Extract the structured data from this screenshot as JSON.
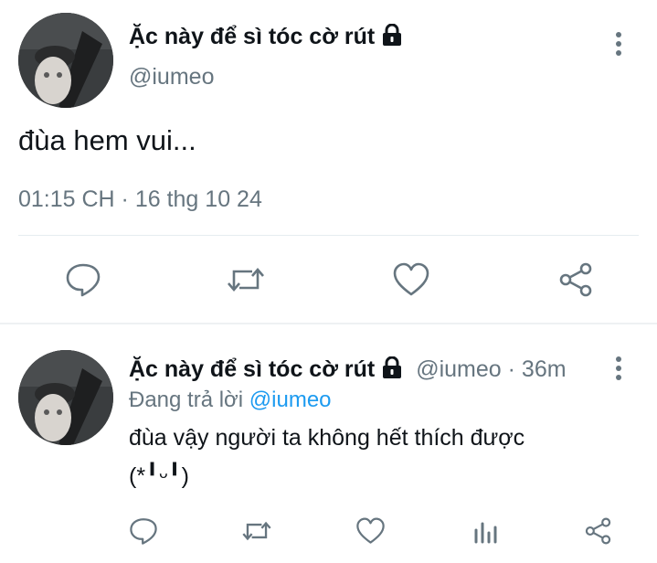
{
  "main_tweet": {
    "display_name": "Ặc này để sì tóc cờ rút",
    "handle": "@iumeo",
    "text": "đùa hem vui...",
    "timestamp": "01:15 CH · 16 thg 10 24",
    "actions": [
      "reply-icon",
      "retweet-icon",
      "like-icon",
      "share-icon"
    ],
    "more_icon": "more-vertical-icon"
  },
  "reply_tweet": {
    "display_name": "Ặc này để sì tóc cờ rút",
    "handle": "@iumeo",
    "separator": "·",
    "time_ago": "36m",
    "replying_prefix": "Đang trả lời",
    "replying_to": "@iumeo",
    "text_line1": "đùa vậy người ta không hết thích được",
    "text_line2": "(*╹ᵕ╹)",
    "actions": [
      "reply-icon",
      "retweet-icon",
      "like-icon",
      "analytics-icon",
      "share-icon"
    ],
    "more_icon": "more-vertical-icon"
  },
  "colors": {
    "text": "#0f1419",
    "muted": "#66757f",
    "link": "#1d9bf0",
    "divider": "#e6ecf0"
  }
}
